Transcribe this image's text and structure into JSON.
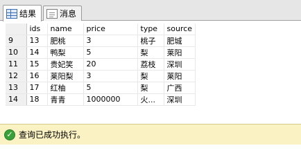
{
  "tabs": [
    {
      "label": "结果",
      "icon": "grid-icon",
      "active": true
    },
    {
      "label": "消息",
      "icon": "document-icon",
      "active": false
    }
  ],
  "grid": {
    "columns": [
      "ids",
      "name",
      "price",
      "type",
      "source"
    ],
    "rows": [
      {
        "rownum": "9",
        "ids": "13",
        "name": "肥桃",
        "price": "3",
        "type": "桃子",
        "source": "肥城"
      },
      {
        "rownum": "10",
        "ids": "14",
        "name": "鸭梨",
        "price": "5",
        "type": "梨",
        "source": "莱阳"
      },
      {
        "rownum": "11",
        "ids": "15",
        "name": "贵妃笑",
        "price": "20",
        "type": "荔枝",
        "source": "深圳"
      },
      {
        "rownum": "12",
        "ids": "16",
        "name": "莱阳梨",
        "price": "3",
        "type": "梨",
        "source": "莱阳"
      },
      {
        "rownum": "13",
        "ids": "17",
        "name": "红柚",
        "price": "5",
        "type": "梨",
        "source": "广西"
      },
      {
        "rownum": "14",
        "ids": "18",
        "name": "青青",
        "price": "1000000",
        "type": "火...",
        "source": "深圳"
      }
    ]
  },
  "status": {
    "text": "查询已成功执行。",
    "icon": "success-check-icon",
    "background": "#fbf2c4",
    "icon_color": "#3aa13a"
  }
}
